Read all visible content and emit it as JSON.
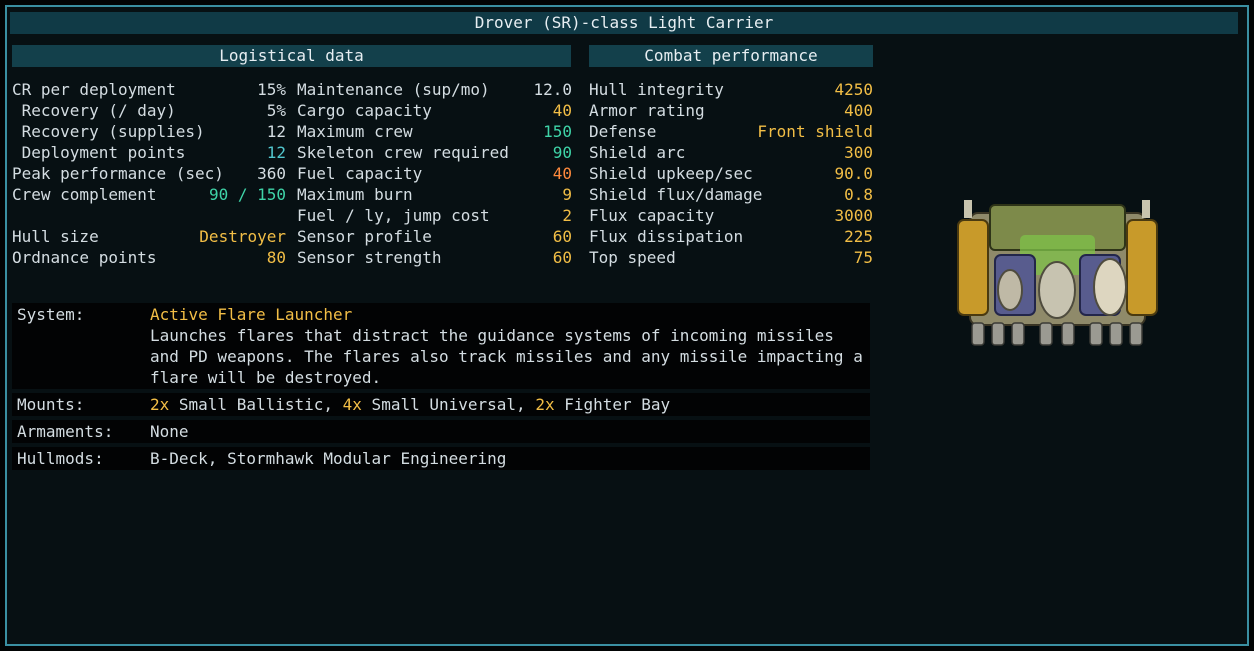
{
  "title": "Drover (SR)-class Light Carrier",
  "logistical": {
    "header": "Logistical data",
    "col1": [
      {
        "label": "CR per deployment",
        "value": "15%",
        "color": "white"
      },
      {
        "label": " Recovery (/ day)",
        "value": "5%",
        "color": "white"
      },
      {
        "label": " Recovery (supplies)",
        "value": "12",
        "color": "white"
      },
      {
        "label": " Deployment points",
        "value": "12",
        "color": "cyan"
      },
      {
        "label": "Peak performance (sec)",
        "value": "360",
        "color": "white"
      },
      {
        "label": "Crew complement",
        "value": "90 / 150",
        "color": "teal"
      },
      {
        "label": "",
        "value": "",
        "color": "white"
      },
      {
        "label": "Hull size",
        "value": "Destroyer",
        "color": "yellow"
      },
      {
        "label": "Ordnance points",
        "value": "80",
        "color": "yellow"
      }
    ],
    "col2": [
      {
        "label": "Maintenance (sup/mo)",
        "value": "12.0",
        "color": "white"
      },
      {
        "label": "Cargo capacity",
        "value": "40",
        "color": "yellow"
      },
      {
        "label": "Maximum crew",
        "value": "150",
        "color": "teal"
      },
      {
        "label": "Skeleton crew required",
        "value": "90",
        "color": "teal"
      },
      {
        "label": "Fuel capacity",
        "value": "40",
        "color": "orange"
      },
      {
        "label": "Maximum burn",
        "value": "9",
        "color": "yellow"
      },
      {
        "label": "Fuel / ly, jump cost",
        "value": "2",
        "color": "yellow"
      },
      {
        "label": "Sensor profile",
        "value": "60",
        "color": "yellow"
      },
      {
        "label": "Sensor strength",
        "value": "60",
        "color": "yellow"
      }
    ]
  },
  "combat": {
    "header": "Combat performance",
    "rows": [
      {
        "label": "Hull integrity",
        "value": "4250",
        "color": "yellow"
      },
      {
        "label": "Armor rating",
        "value": "400",
        "color": "yellow"
      },
      {
        "label": "Defense",
        "value": "Front shield",
        "color": "yellow"
      },
      {
        "label": "Shield arc",
        "value": "300",
        "color": "yellow"
      },
      {
        "label": "Shield upkeep/sec",
        "value": "90.0",
        "color": "yellow"
      },
      {
        "label": "Shield flux/damage",
        "value": "0.8",
        "color": "yellow"
      },
      {
        "label": "Flux capacity",
        "value": "3000",
        "color": "yellow"
      },
      {
        "label": "Flux dissipation",
        "value": "225",
        "color": "yellow"
      },
      {
        "label": "Top speed",
        "value": "75",
        "color": "yellow"
      }
    ]
  },
  "system": {
    "label": "System:",
    "name": "Active Flare Launcher",
    "description": "Launches flares that distract the guidance systems of incoming missiles and PD weapons. The flares also track missiles and any missile impacting a flare will be destroyed."
  },
  "mounts": {
    "label": "Mounts:",
    "items": [
      {
        "count": "2x",
        "text": " Small Ballistic, "
      },
      {
        "count": "4x",
        "text": " Small Universal, "
      },
      {
        "count": "2x",
        "text": " Fighter Bay"
      }
    ]
  },
  "armaments": {
    "label": "Armaments:",
    "value": "None"
  },
  "hullmods": {
    "label": "Hullmods:",
    "value": "B-Deck, Stormhawk Modular Engineering"
  },
  "colors": {
    "white": "#d4dde2",
    "yellow": "#f2be46",
    "teal": "#3fd4a8",
    "cyan": "#52c7ce",
    "orange": "#ff8a3d",
    "border": "#3a8fa2",
    "header_bg": "#13404b"
  },
  "ship_icon": "drover-carrier-sprite"
}
